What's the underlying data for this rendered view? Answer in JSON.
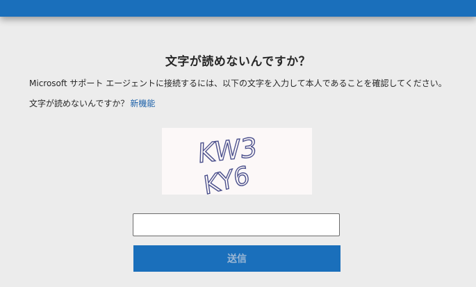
{
  "page": {
    "title": "文字が読めないんですか？",
    "description": "Microsoft サポート エージェントに接続するには、以下の文字を入力して本人であることを確認してください。",
    "help_text": "文字が読めないんですか？",
    "help_link": "新機能"
  },
  "captcha": {
    "line1": "KW3",
    "line2": "KY6",
    "ink_color": "#4a4f8c"
  },
  "form": {
    "input_value": "",
    "submit_label": "送信"
  },
  "colors": {
    "accent": "#1a6fbb",
    "background": "#ececec",
    "link": "#1a5fa8"
  }
}
